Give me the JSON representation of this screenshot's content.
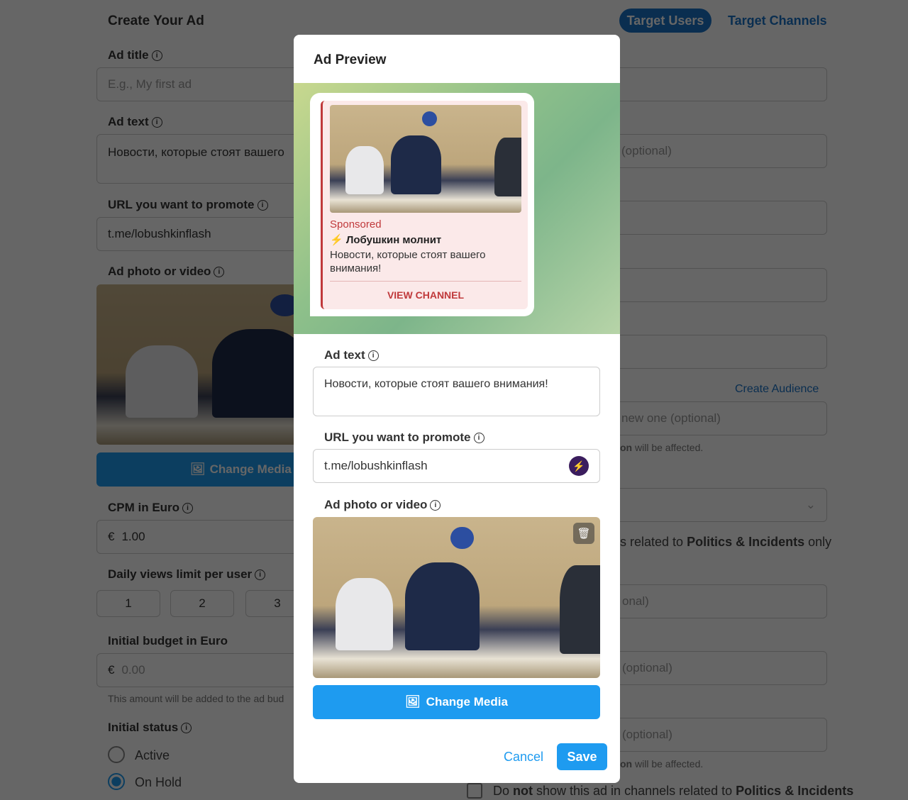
{
  "page": {
    "title": "Create Your Ad",
    "tabs": [
      {
        "label": "Target Users",
        "active": true
      },
      {
        "label": "Target Channels",
        "active": false
      }
    ],
    "ad_title": {
      "label": "Ad title",
      "placeholder": "E.g., My first ad"
    },
    "ad_text": {
      "label": "Ad text",
      "value": "Новости, которые стоят вашего"
    },
    "url": {
      "label": "URL you want to promote",
      "value": "t.me/lobushkinflash"
    },
    "photo": {
      "label": "Ad photo or video",
      "change_label": "Change Media"
    },
    "cpm": {
      "label": "CPM in Euro",
      "currency": "€",
      "value": "1.00"
    },
    "daily": {
      "label": "Daily views limit per user",
      "options": [
        "1",
        "2",
        "3"
      ]
    },
    "budget": {
      "label": "Initial budget in Euro",
      "currency": "€",
      "placeholder": "0.00",
      "hint": "This amount will be added to the ad bud"
    },
    "status": {
      "label": "Initial status",
      "options": [
        {
          "label": "Active",
          "selected": false
        },
        {
          "label": "On Hold",
          "selected": true
        }
      ]
    },
    "right": {
      "field2": "(optional)",
      "create_audience": "Create Audience",
      "field6": "new one (optional)",
      "affected_bold": "on",
      "affected": " will be affected.",
      "politics_pre": "s related to ",
      "politics_bold": "Politics & Incidents",
      "politics_post": " only",
      "field8": "onal)",
      "field9": "(optional)",
      "field10": "(optional)",
      "affected2_bold": "on",
      "affected2": " will be affected.",
      "notshow_pre": "Do ",
      "notshow_not": "not",
      "notshow_mid": " show this ad in channels related to ",
      "notshow_bold": "Politics & Incidents"
    }
  },
  "modal": {
    "title": "Ad Preview",
    "preview": {
      "sponsored": "Sponsored",
      "channel_emoji": "⚡",
      "channel": "Лобушкин молнит",
      "text": "Новости, которые стоят вашего внимания!",
      "cta": "VIEW CHANNEL"
    },
    "ad_text": {
      "label": "Ad text",
      "value": "Новости, которые стоят вашего внимания!"
    },
    "url": {
      "label": "URL you want to promote",
      "value": "t.me/lobushkinflash"
    },
    "photo": {
      "label": "Ad photo or video",
      "change_label": "Change Media"
    },
    "cancel": "Cancel",
    "save": "Save"
  },
  "colors": {
    "accent": "#1e9bf0",
    "tab_active": "#1a73c8",
    "sponsored": "#c0393b",
    "overlay": "rgba(0,0,0,0.6)"
  }
}
